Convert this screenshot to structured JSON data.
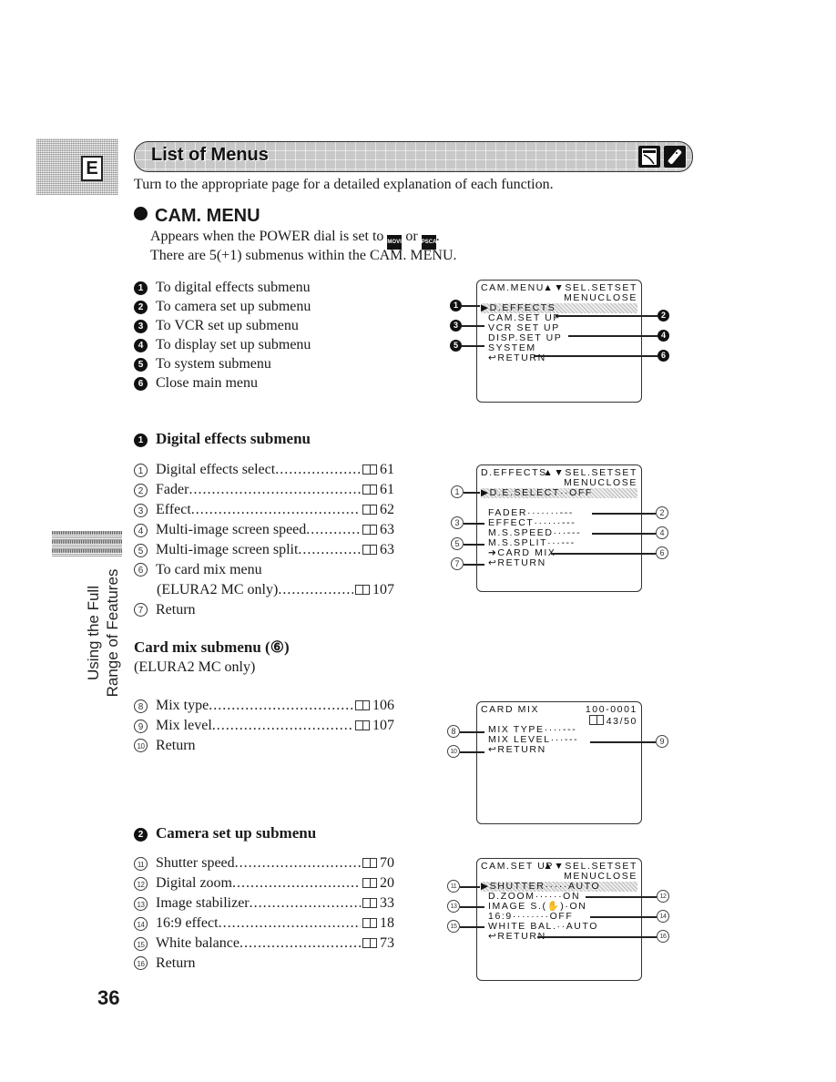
{
  "header": {
    "tab_letter": "E",
    "title": "List of Menus",
    "icons": [
      "menu-screen-icon",
      "remote-control-icon"
    ],
    "intro": "Turn to the appropriate page for a detailed explanation of each function."
  },
  "cam_menu": {
    "title": "CAM. MENU",
    "desc_line1_prefix": "Appears when the POWER dial is set to",
    "badge_movie": "MOVIE",
    "desc_or": "or",
    "badge_pscan": "PSCAN",
    "desc_line2": "There are 5(+1) submenus within the CAM. MENU.",
    "items": [
      {
        "num": "1",
        "label": "To digital effects submenu"
      },
      {
        "num": "2",
        "label": "To camera set up submenu"
      },
      {
        "num": "3",
        "label": "To VCR set up submenu"
      },
      {
        "num": "4",
        "label": "To display set up submenu"
      },
      {
        "num": "5",
        "label": "To system submenu"
      },
      {
        "num": "6",
        "label": "Close main menu"
      }
    ],
    "screen": {
      "title": "CAM.MENU",
      "nav": "▲▼SEL.SETSET",
      "close": "MENUCLOSE",
      "lines": [
        "▶D.EFFECTS",
        "CAM.SET UP",
        "VCR SET UP",
        "DISP.SET UP",
        "SYSTEM",
        "↩RETURN"
      ]
    }
  },
  "digital_effects": {
    "num": "1",
    "title": "Digital effects submenu",
    "items": [
      {
        "num": "1",
        "label": "Digital effects select",
        "page": "61"
      },
      {
        "num": "2",
        "label": "Fader",
        "page": "61"
      },
      {
        "num": "3",
        "label": "Effect",
        "page": "62"
      },
      {
        "num": "4",
        "label": "Multi-image screen speed",
        "page": "63"
      },
      {
        "num": "5",
        "label": "Multi-image screen split",
        "page": "63"
      },
      {
        "num": "6",
        "label": "To card mix menu",
        "label2": "(ELURA2 MC only)",
        "page": "107"
      },
      {
        "num": "7",
        "label": "Return"
      }
    ],
    "screen": {
      "title": "D.EFFECTS",
      "nav": "▲▼SEL.SETSET",
      "close": "MENUCLOSE",
      "lines": [
        "▶D.E.SELECT··OFF",
        "FADER·······---",
        "EFFECT······---",
        "M.S.SPEED···---",
        "M.S.SPLIT···---",
        "➔CARD MIX",
        "↩RETURN"
      ]
    }
  },
  "card_mix": {
    "title": "Card mix submenu (⑥)",
    "note": "(ELURA2 MC only)",
    "items": [
      {
        "num": "8",
        "label": "Mix type",
        "page": "106"
      },
      {
        "num": "9",
        "label": "Mix level",
        "page": "107"
      },
      {
        "num": "10",
        "label": "Return"
      }
    ],
    "screen": {
      "title": "CARD MIX",
      "file": "100-0001",
      "count": "43/50",
      "lines": [
        "MIX TYPE····---",
        "MIX LEVEL···---",
        "↩RETURN"
      ]
    }
  },
  "camera_setup": {
    "num": "2",
    "title": "Camera set up submenu",
    "items": [
      {
        "num": "11",
        "label": "Shutter speed",
        "page": "70"
      },
      {
        "num": "12",
        "label": "Digital zoom",
        "page": "20"
      },
      {
        "num": "13",
        "label": "Image stabilizer",
        "page": "33"
      },
      {
        "num": "14",
        "label": "16:9 effect",
        "page": "18"
      },
      {
        "num": "15",
        "label": "White balance",
        "page": "73"
      },
      {
        "num": "16",
        "label": "Return"
      }
    ],
    "screen": {
      "title": "CAM.SET UP",
      "nav": "▲▼SEL.SETSET",
      "close": "MENUCLOSE",
      "lines": [
        "▶SHUTTER·····AUTO",
        "D.ZOOM······ON",
        "IMAGE S.(✋)·ON",
        "16:9········OFF",
        "WHITE BAL.··AUTO",
        "↩RETURN"
      ]
    }
  },
  "side_tab": {
    "line1": "Using the Full",
    "line2": "Range of Features"
  },
  "page_number": "36"
}
